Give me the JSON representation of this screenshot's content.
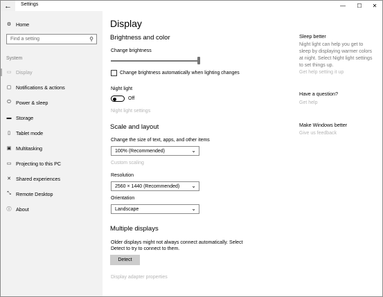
{
  "window": {
    "title": "Settings",
    "back_glyph": "←",
    "minimize_glyph": "—",
    "maximize_glyph": "☐",
    "close_glyph": "✕"
  },
  "sidebar": {
    "home": "Home",
    "search_placeholder": "Find a setting",
    "section": "System",
    "items": [
      {
        "label": "Display",
        "icon": "display-icon",
        "glyph": "▭",
        "active": true
      },
      {
        "label": "Notifications & actions",
        "icon": "notifications-icon",
        "glyph": "▢"
      },
      {
        "label": "Power & sleep",
        "icon": "power-icon",
        "glyph": "⏻"
      },
      {
        "label": "Storage",
        "icon": "storage-icon",
        "glyph": "▬"
      },
      {
        "label": "Tablet mode",
        "icon": "tablet-icon",
        "glyph": "▯"
      },
      {
        "label": "Multitasking",
        "icon": "multitasking-icon",
        "glyph": "▣"
      },
      {
        "label": "Projecting to this PC",
        "icon": "projecting-icon",
        "glyph": "▭"
      },
      {
        "label": "Shared experiences",
        "icon": "shared-icon",
        "glyph": "✕"
      },
      {
        "label": "Remote Desktop",
        "icon": "remote-desktop-icon",
        "glyph": "⤡"
      },
      {
        "label": "About",
        "icon": "about-icon",
        "glyph": "ⓘ"
      }
    ]
  },
  "main": {
    "title": "Display",
    "brightness": {
      "heading": "Brightness and color",
      "change_label": "Change brightness",
      "level_fraction": 1.0,
      "auto_checkbox_label": "Change brightness automatically when lighting changes",
      "auto_checked": false,
      "night_light_label": "Night light",
      "night_light_state": "Off",
      "night_light_settings": "Night light settings"
    },
    "scale": {
      "heading": "Scale and layout",
      "size_label": "Change the size of text, apps, and other items",
      "size_value": "100% (Recommended)",
      "custom_scaling": "Custom scaling",
      "resolution_label": "Resolution",
      "resolution_value": "2560 × 1440 (Recommended)",
      "orientation_label": "Orientation",
      "orientation_value": "Landscape"
    },
    "multiple": {
      "heading": "Multiple displays",
      "description_line1": "Older displays might not always connect automatically. Select",
      "description_line2": "Detect to try to connect to them.",
      "detect_button": "Detect",
      "adapter_link": "Display adapter properties"
    }
  },
  "right": {
    "sleep_heading": "Sleep better",
    "sleep_line1": "Night light can help you get to",
    "sleep_line2": "sleep by displaying warmer colors",
    "sleep_line3": "at night. Select Night light settings",
    "sleep_line4": "to set things up.",
    "sleep_link": "Get help setting it up",
    "question_heading": "Have a question?",
    "question_link": "Get help",
    "better_heading": "Make Windows better",
    "better_link": "Give us feedback"
  }
}
